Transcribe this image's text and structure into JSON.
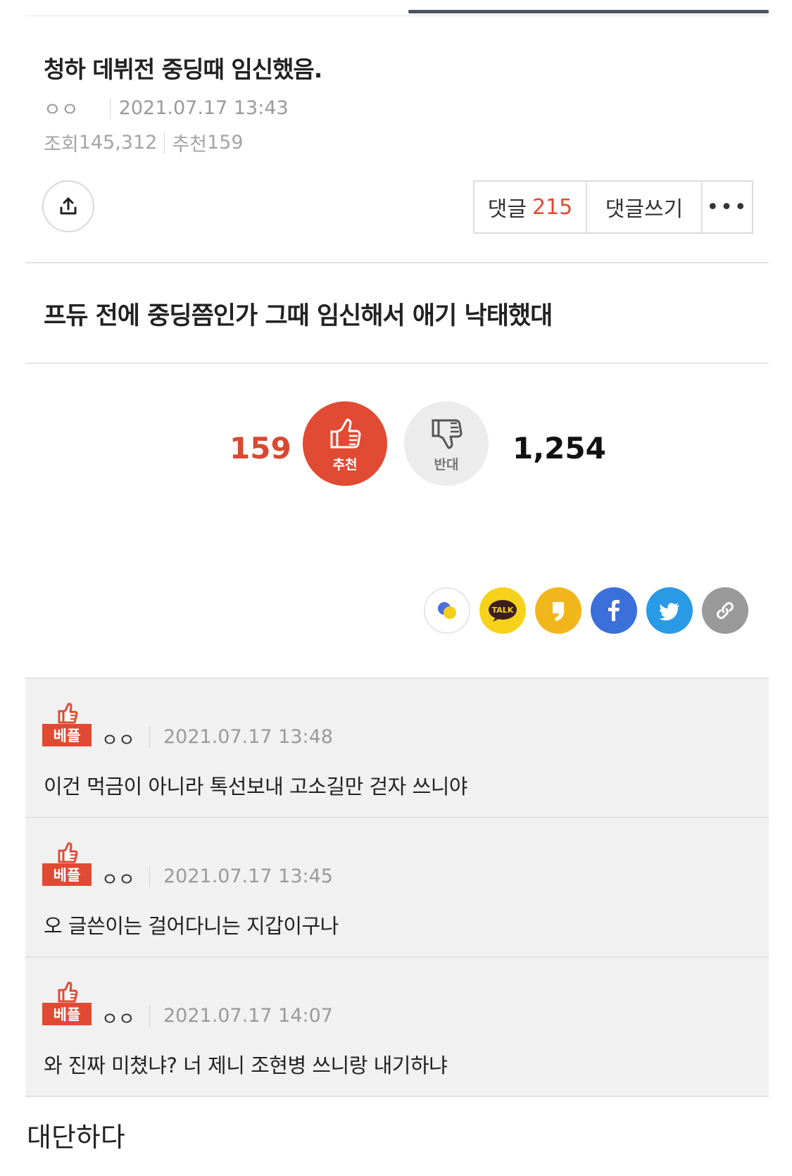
{
  "post": {
    "title": "청하 데뷔전 중딩때 임신했음.",
    "author": "ㅇㅇ",
    "datetime": "2021.07.17 13:43",
    "views_label": "조회",
    "views": "145,312",
    "likes_label": "추천",
    "likes": "159",
    "body": "프듀 전에 중딩쯤인가 그때 임신해서 애기 낙태했대"
  },
  "toolbar": {
    "comments_label": "댓글",
    "comments_count": "215",
    "write_label": "댓글쓰기",
    "more_label": "•••"
  },
  "votes": {
    "up_count": "159",
    "up_label": "추천",
    "down_label": "반대",
    "down_count": "1,254"
  },
  "share_icons": [
    "kakao-story-icon",
    "kakaotalk-icon",
    "kakao-page-icon",
    "facebook-icon",
    "twitter-icon",
    "link-icon"
  ],
  "share_text": {
    "talk": "TALK"
  },
  "comments": [
    {
      "badge": "베플",
      "author": "ㅇㅇ",
      "datetime": "2021.07.17 13:48",
      "text": "이건 먹금이 아니라 톡선보내 고소길만 걷자 쓰니야"
    },
    {
      "badge": "베플",
      "author": "ㅇㅇ",
      "datetime": "2021.07.17 13:45",
      "text": "오 글쓴이는 걸어다니는 지갑이구나"
    },
    {
      "badge": "베플",
      "author": "ㅇㅇ",
      "datetime": "2021.07.17 14:07",
      "text": "와 진짜 미쳤냐? 너 제니 조현병 쓰니랑 내기하냐"
    }
  ],
  "caption": "대단하다",
  "colors": {
    "accent": "#e14a33",
    "facebook": "#3b6fd9",
    "twitter": "#2a9ae6",
    "kakao": "#f7d21c",
    "link": "#9a9a9a"
  }
}
